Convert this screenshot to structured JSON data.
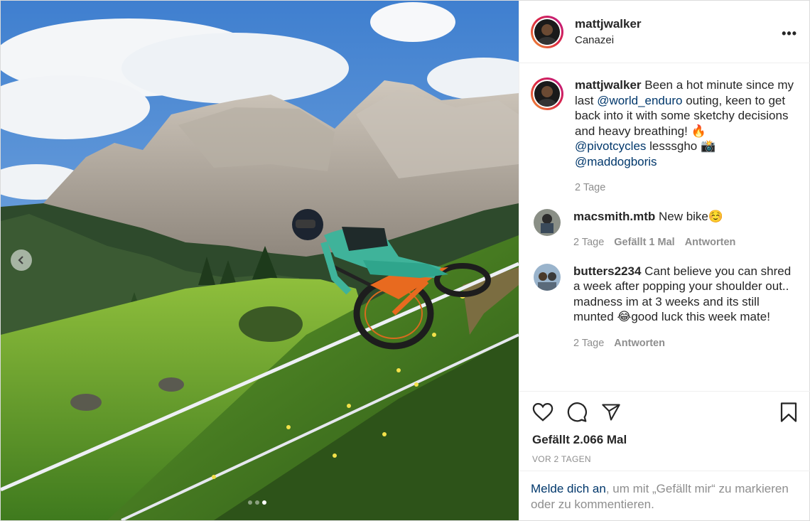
{
  "post": {
    "username": "mattjwalker",
    "location": "Canazei",
    "more_icon": "more-horizontal-icon",
    "caption": {
      "username": "mattjwalker",
      "text1": " Been a hot minute since my last ",
      "mention1": "@world_enduro",
      "text2": " outing, keen to get back into it with some sketchy decisions and heavy breathing! ",
      "emoji_fire": "🔥",
      "mention2": "@pivotcycles",
      "text3": " lesssgho ",
      "emoji_camera": "📸",
      "mention3": "@maddogboris",
      "time": "2 Tage"
    },
    "comments": [
      {
        "username": "macsmith.mtb",
        "text": " New bike",
        "emoji": "☺️",
        "time": "2 Tage",
        "likes": "Gefällt 1 Mal",
        "reply": "Antworten"
      },
      {
        "username": "butters2234",
        "text": " Cant believe you can shred a week after popping your shoulder out.. madness im at 3 weeks and its still munted ",
        "emoji": "😂",
        "text_after": "good luck this week mate!",
        "time": "2 Tage",
        "reply": "Antworten"
      }
    ],
    "likes_count": "Gefällt 2.066 Mal",
    "date": "VOR 2 TAGEN",
    "login_prompt": {
      "link": "Melde dich an",
      "text": ", um mit „Gefällt mir“ zu markieren oder zu kommentieren."
    },
    "carousel": {
      "slide_count": 3,
      "active_index": 2
    }
  }
}
